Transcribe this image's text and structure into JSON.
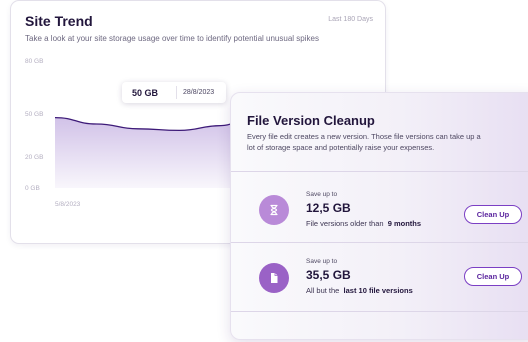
{
  "site_trend": {
    "title": "Site Trend",
    "range": "Last 180 Days",
    "description": "Take a look at your site storage usage over time to identify potential unusual spikes",
    "tooltip": {
      "value": "50 GB",
      "date": "28/8/2023"
    },
    "chart_data": {
      "type": "area",
      "y_ticks": [
        "80 GB",
        "50 GB",
        "20 GB",
        "0 GB"
      ],
      "x_tick": "5/8/2023",
      "accent": "#3d1a78",
      "fill": "#c9b7e4",
      "series": [
        {
          "values": [
            44,
            40,
            37,
            36,
            39,
            50,
            48,
            41,
            36
          ]
        }
      ],
      "ylim": [
        0,
        80
      ],
      "grid": false
    }
  },
  "cleanup": {
    "title": "File Version Cleanup",
    "description": "Every file edit creates a new version. Those file versions can take up a lot of storage space and potentially raise your expenses.",
    "options": [
      {
        "icon": "hourglass-icon",
        "icon_color": "#b98ad8",
        "label": "Save up to",
        "amount": "12,5 GB",
        "detail_prefix": "File versions older than",
        "detail_emphasis": "9 months",
        "button": "Clean Up"
      },
      {
        "icon": "document-icon",
        "icon_color": "#9a62c6",
        "label": "Save up to",
        "amount": "35,5 GB",
        "detail_prefix": "All but the",
        "detail_emphasis": "last 10 file versions",
        "button": "Clean Up"
      }
    ]
  }
}
